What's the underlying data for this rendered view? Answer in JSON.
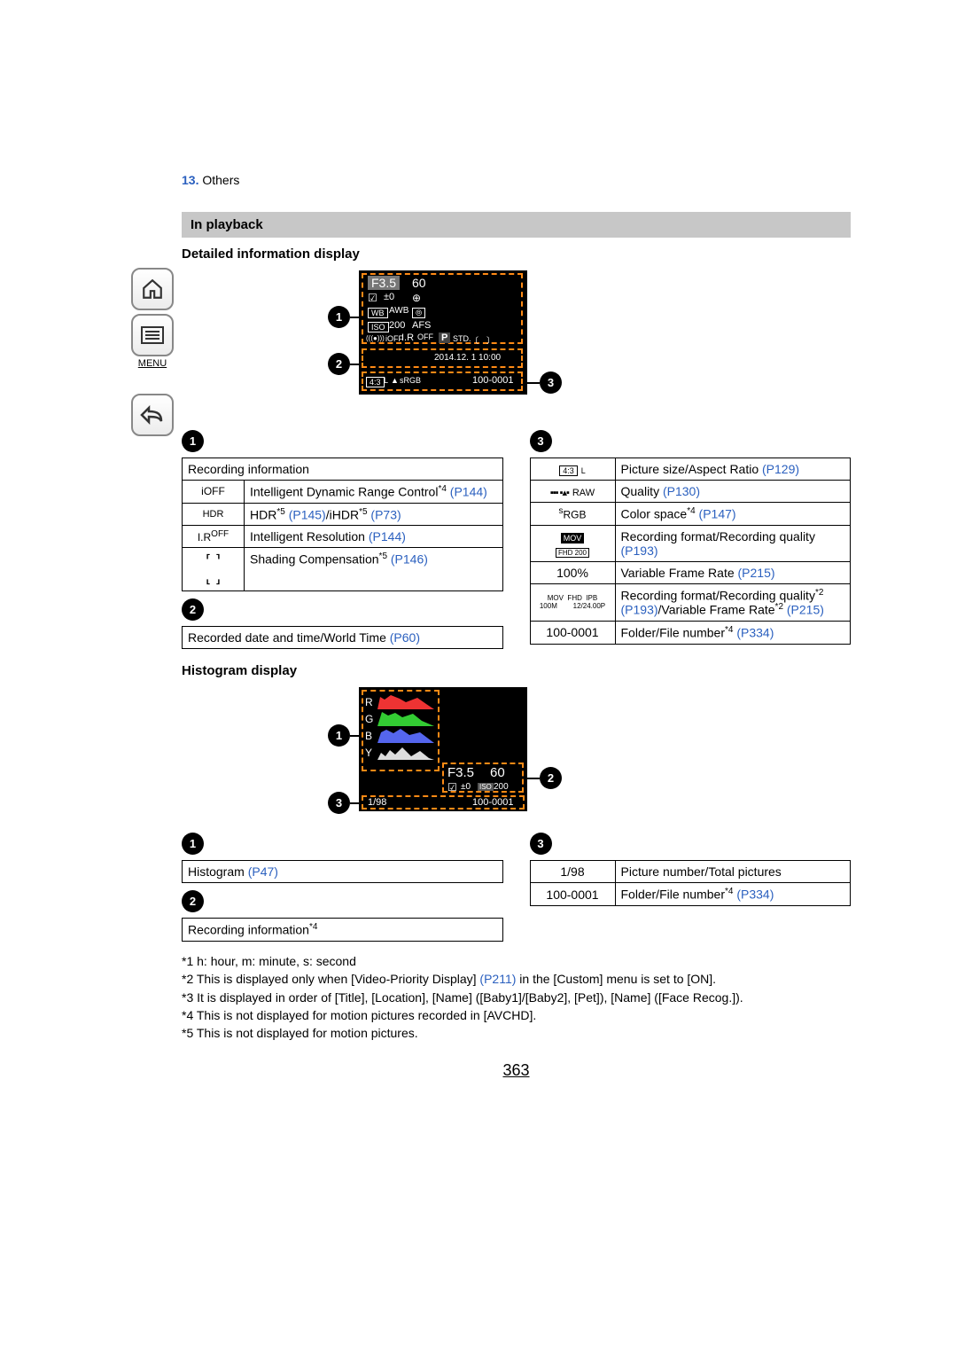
{
  "breadcrumb": {
    "number": "13.",
    "text": "Others"
  },
  "sidebar": {
    "menu": "MENU"
  },
  "section_title": "In playback",
  "detailed": {
    "heading": "Detailed information display",
    "cam": {
      "aperture": "F3.5",
      "shutter": "60",
      "ev_label": "±0",
      "wb": "WB",
      "awb": "AWB",
      "iso_label": "ISO",
      "iso_val": "200",
      "afs": "AFS",
      "ir": "I.R",
      "ioff": "iOFF",
      "p": "P",
      "std": "STD.",
      "date": "2014.12. 1 10:00",
      "ratio": "4:3",
      "size": "L",
      "srgb": "sRGB",
      "file": "100-0001"
    },
    "t1": {
      "row0": "Recording information",
      "r1_icon": "iOFF",
      "r1_t": "Intelligent Dynamic Range Control",
      "r1_s": "*4",
      "r1_l": "(P144)",
      "r2_icon": "HDR",
      "r2_a": "HDR",
      "r2_as": "*5",
      "r2_al": "(P145)",
      "r2_b": "/iHDR",
      "r2_bs": "*5",
      "r2_bl": "(P73)",
      "r3_icon": "I.R",
      "r3_t": "Intelligent Resolution ",
      "r3_l": "(P144)",
      "r4_t": "Shading Compensation",
      "r4_s": "*5",
      "r4_l": "(P146)",
      "sec2": "Recorded date and time/World Time ",
      "sec2_l": "(P60)"
    },
    "t3": {
      "r1_icon": "4:3 L",
      "r1_t": "Picture size/Aspect Ratio ",
      "r1_l": "(P129)",
      "r2_icon": "RAW",
      "r2_t": "Quality ",
      "r2_l": "(P130)",
      "r3_icon": "sRGB",
      "r3_t": "Color space",
      "r3_s": "*4",
      "r3_l": "(P147)",
      "r4_icon": "MOV",
      "r4_t": "Recording format/Recording quality ",
      "r4_l": "(P193)",
      "r5_icon": "100%",
      "r5_t": "Variable Frame Rate ",
      "r5_l": "(P215)",
      "r6_icon": "MOV FHD IPB 12/24.00P",
      "r6_icon_sz": "100M",
      "r6_t": "Recording format/Recording quality",
      "r6_s": "*2",
      "r6_l1": "(P193)",
      "r6_t2": "/Variable Frame Rate",
      "r6_s2": "*2",
      "r6_l2": "(P215)",
      "r7_icon": "100-0001",
      "r7_t": "Folder/File number",
      "r7_s": "*4",
      "r7_l": "(P334)"
    }
  },
  "histogram": {
    "heading": "Histogram display",
    "letters": {
      "r": "R",
      "g": "G",
      "b": "B",
      "y": "Y"
    },
    "aperture": "F3.5",
    "shutter": "60",
    "ev": "±0",
    "iso_l": "ISO",
    "iso_v": "200",
    "frame": "1/98",
    "file": "100-0001",
    "t1": {
      "text": "Histogram ",
      "link": "(P47)"
    },
    "t2": {
      "text_a": "Recording information",
      "sup": "*4"
    },
    "t3": {
      "r1_i": "1/98",
      "r1_t": "Picture number/Total pictures",
      "r2_i": "100-0001",
      "r2_t": "Folder/File number",
      "r2_s": "*4",
      "r2_l": "(P334)"
    }
  },
  "footnotes": {
    "f1": "*1 h: hour, m: minute, s: second",
    "f2a": "*2 This is displayed only when [Video-Priority Display] ",
    "f2l": "(P211)",
    "f2b": " in the [Custom] menu is set to [ON].",
    "f3": "*3 It is displayed in order of [Title], [Location], [Name] ([Baby1]/[Baby2], [Pet]), [Name] ([Face Recog.]).",
    "f4": "*4 This is not displayed for motion pictures recorded in [AVCHD].",
    "f5": "*5 This is not displayed for motion pictures."
  },
  "page": "363"
}
